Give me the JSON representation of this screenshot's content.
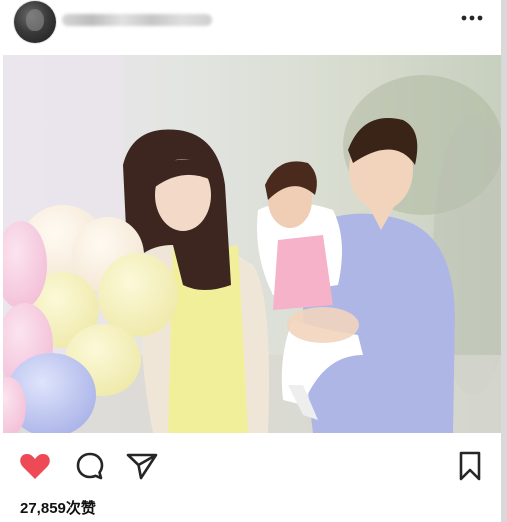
{
  "post": {
    "likes_text": "27,859次赞",
    "liked": true
  },
  "header": {
    "more_icon": "more-horizontal-icon",
    "username_blurred": true
  },
  "actions": {
    "like_icon": "heart-filled-icon",
    "comment_icon": "comment-bubble-icon",
    "share_icon": "paper-plane-icon",
    "save_icon": "bookmark-icon"
  },
  "colors": {
    "like_red": "#ed4956",
    "icon": "#262626",
    "text": "#111111"
  }
}
